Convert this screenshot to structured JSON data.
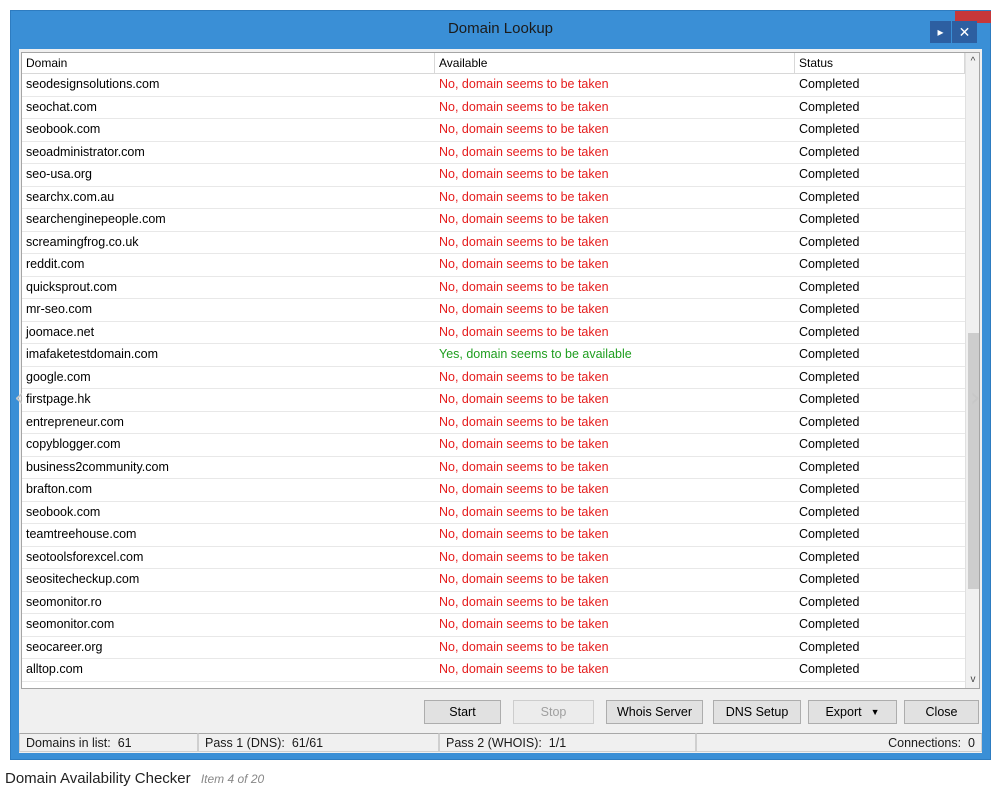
{
  "window": {
    "title": "Domain Lookup",
    "close_glyph": "✕",
    "next_glyph": "▸"
  },
  "columns": [
    "Domain",
    "Available",
    "Status"
  ],
  "rows": [
    {
      "domain": "seodesignsolutions.com",
      "available": "No, domain seems to be taken",
      "status": "Completed",
      "ok": false
    },
    {
      "domain": "seochat.com",
      "available": "No, domain seems to be taken",
      "status": "Completed",
      "ok": false
    },
    {
      "domain": "seobook.com",
      "available": "No, domain seems to be taken",
      "status": "Completed",
      "ok": false
    },
    {
      "domain": "seoadministrator.com",
      "available": "No, domain seems to be taken",
      "status": "Completed",
      "ok": false
    },
    {
      "domain": "seo-usa.org",
      "available": "No, domain seems to be taken",
      "status": "Completed",
      "ok": false
    },
    {
      "domain": "searchx.com.au",
      "available": "No, domain seems to be taken",
      "status": "Completed",
      "ok": false
    },
    {
      "domain": "searchenginepeople.com",
      "available": "No, domain seems to be taken",
      "status": "Completed",
      "ok": false
    },
    {
      "domain": "screamingfrog.co.uk",
      "available": "No, domain seems to be taken",
      "status": "Completed",
      "ok": false
    },
    {
      "domain": "reddit.com",
      "available": "No, domain seems to be taken",
      "status": "Completed",
      "ok": false
    },
    {
      "domain": "quicksprout.com",
      "available": "No, domain seems to be taken",
      "status": "Completed",
      "ok": false
    },
    {
      "domain": "mr-seo.com",
      "available": "No, domain seems to be taken",
      "status": "Completed",
      "ok": false
    },
    {
      "domain": "joomace.net",
      "available": "No, domain seems to be taken",
      "status": "Completed",
      "ok": false
    },
    {
      "domain": "imafaketestdomain.com",
      "available": "Yes, domain seems to be available",
      "status": "Completed",
      "ok": true
    },
    {
      "domain": "google.com",
      "available": "No, domain seems to be taken",
      "status": "Completed",
      "ok": false
    },
    {
      "domain": "firstpage.hk",
      "available": "No, domain seems to be taken",
      "status": "Completed",
      "ok": false
    },
    {
      "domain": "entrepreneur.com",
      "available": "No, domain seems to be taken",
      "status": "Completed",
      "ok": false
    },
    {
      "domain": "copyblogger.com",
      "available": "No, domain seems to be taken",
      "status": "Completed",
      "ok": false
    },
    {
      "domain": "business2community.com",
      "available": "No, domain seems to be taken",
      "status": "Completed",
      "ok": false
    },
    {
      "domain": "brafton.com",
      "available": "No, domain seems to be taken",
      "status": "Completed",
      "ok": false
    },
    {
      "domain": "seobook.com",
      "available": "No, domain seems to be taken",
      "status": "Completed",
      "ok": false
    },
    {
      "domain": "teamtreehouse.com",
      "available": "No, domain seems to be taken",
      "status": "Completed",
      "ok": false
    },
    {
      "domain": "seotoolsforexcel.com",
      "available": "No, domain seems to be taken",
      "status": "Completed",
      "ok": false
    },
    {
      "domain": "seositecheckup.com",
      "available": "No, domain seems to be taken",
      "status": "Completed",
      "ok": false
    },
    {
      "domain": "seomonitor.ro",
      "available": "No, domain seems to be taken",
      "status": "Completed",
      "ok": false
    },
    {
      "domain": "seomonitor.com",
      "available": "No, domain seems to be taken",
      "status": "Completed",
      "ok": false
    },
    {
      "domain": "seocareer.org",
      "available": "No, domain seems to be taken",
      "status": "Completed",
      "ok": false
    },
    {
      "domain": "alltop.com",
      "available": "No, domain seems to be taken",
      "status": "Completed",
      "ok": false
    }
  ],
  "buttons": {
    "start": "Start",
    "stop": "Stop",
    "whois": "Whois Server",
    "dns": "DNS Setup",
    "export": "Export",
    "export_caret": "▼",
    "close": "Close"
  },
  "status": {
    "domains_label": "Domains in list:",
    "domains_value": "61",
    "pass1_label": "Pass 1 (DNS):",
    "pass1_value": "61/61",
    "pass2_label": "Pass 2 (WHOIS):",
    "pass2_value": "1/1",
    "connections_label": "Connections:",
    "connections_value": "0"
  },
  "caption": {
    "title": "Domain Availability Checker",
    "subtitle": "Item 4 of 20"
  },
  "colors": {
    "taken": "#e51c1c",
    "available": "#1f9e1f",
    "titlebar": "#3a8fd6"
  }
}
